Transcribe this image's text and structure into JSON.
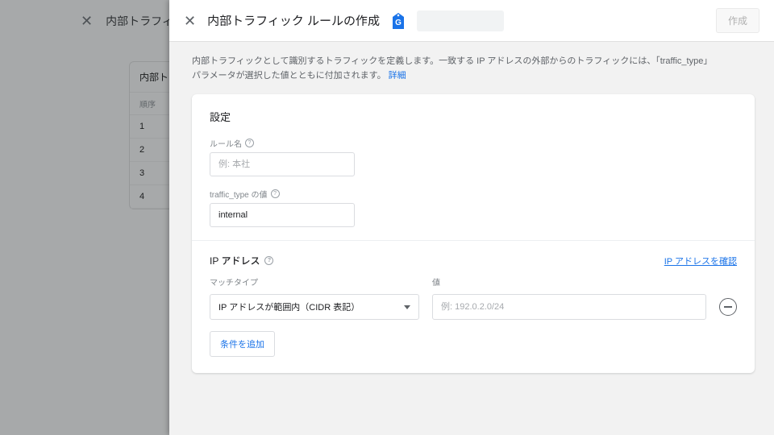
{
  "bg": {
    "title": "内部トラフィ",
    "card_head": "内部ト",
    "col": "順序",
    "rows": [
      "1",
      "2",
      "3",
      "4"
    ]
  },
  "header": {
    "title": "内部トラフィック ルールの作成",
    "create": "作成"
  },
  "desc": {
    "text": "内部トラフィックとして識別するトラフィックを定義します。一致する IP アドレスの外部からのトラフィックには、「traffic_type」パラメータが選択した値とともに付加されます。",
    "link": "詳細"
  },
  "settings": {
    "title": "設定",
    "rule_name_label": "ルール名",
    "rule_name_placeholder": "例: 本社",
    "traffic_type_label": "traffic_type の値",
    "traffic_type_value": "internal"
  },
  "ip": {
    "title": "IP アドレス",
    "confirm_link": "IP アドレスを確認",
    "match_label": "マッチタイプ",
    "match_value": "IP アドレスが範囲内（CIDR 表記）",
    "value_label": "値",
    "value_placeholder": "例: 192.0.2.0/24",
    "add_condition": "条件を追加"
  }
}
